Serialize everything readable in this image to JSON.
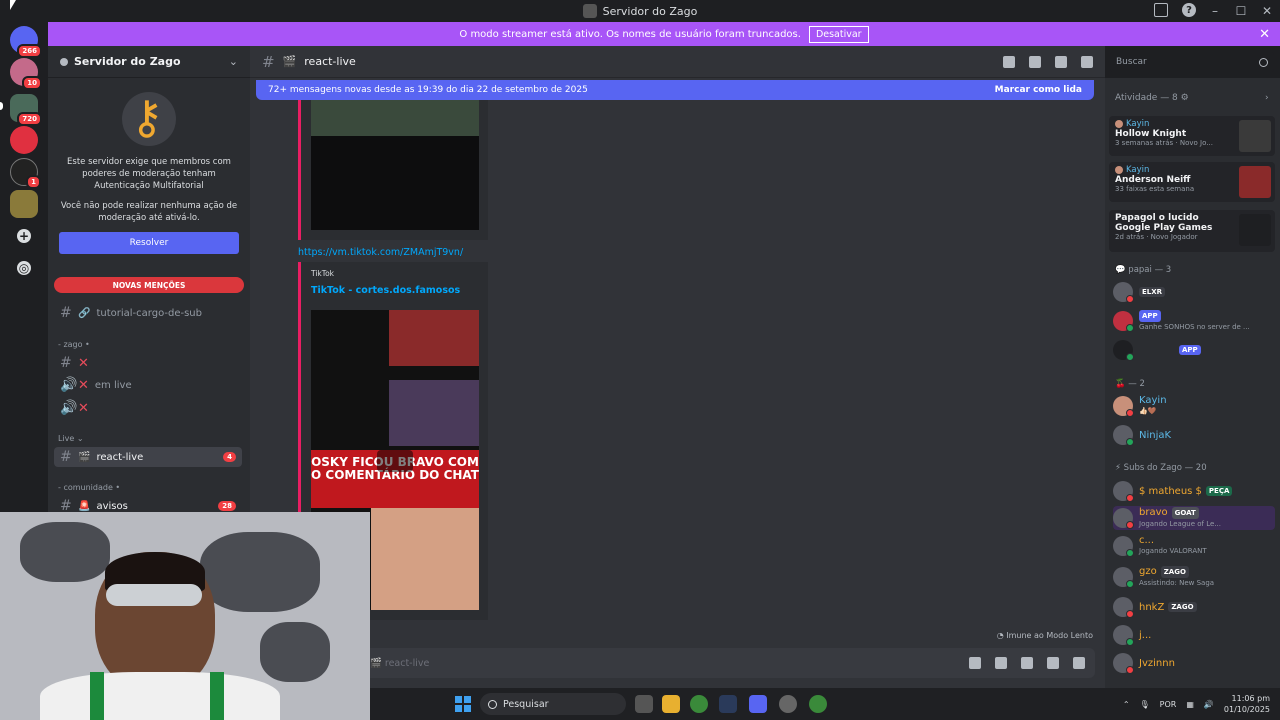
{
  "window": {
    "title": "Servidor do Zago"
  },
  "rail": {
    "badges": [
      "266",
      "10",
      "720",
      "1"
    ]
  },
  "banner": {
    "text": "O modo streamer está ativo. Os nomes de usuário foram truncados.",
    "button": "Desativar"
  },
  "sidebar": {
    "server_name": "Servidor do Zago",
    "mfa_text1": "Este servidor exige que membros com poderes de moderação tenham Autenticação Multifatorial",
    "mfa_text2": "Você não pode realizar nenhuma ação de moderação até ativá-lo.",
    "resolve": "Resolver",
    "new_mentions": "NOVAS MENÇÕES",
    "channels": [
      {
        "name": "tutorial-cargo-de-sub"
      },
      {
        "name": "em live"
      },
      {
        "name": "react-live",
        "count": "4"
      },
      {
        "name": "avisos",
        "count": "28"
      }
    ],
    "categories": [
      "zago",
      "Live",
      "comunidade"
    ]
  },
  "chat": {
    "channel": "react-live",
    "new_messages": "72+ mensagens novas desde as 19:39 do dia 22 de setembro de 2025",
    "mark_read": "Marcar como lida",
    "link": "https://vm.tiktok.com/ZMAmjT9vn/",
    "embed_provider": "TikTok",
    "embed_title": "TikTok - cortes.dos.famosos",
    "video_caption": "OSKY FICOU BRAVO COM O COMENTÁRIO DO CHAT",
    "slow_mode": "Imune ao Modo Lento",
    "composer_placeholder": "react-live"
  },
  "search": {
    "placeholder": "Buscar"
  },
  "members": {
    "activity_header": "Atividade — 8",
    "activities": [
      {
        "who": "Kayin",
        "what": "Hollow Knight",
        "meta": "3 semanas atrás · Novo Jo..."
      },
      {
        "who": "Kayin",
        "what": "Anderson Neiff",
        "meta": "33 faixas esta semana"
      },
      {
        "who": "",
        "what": "Papagol o lucido",
        "what2": "Google Play Games",
        "meta": "2d atrás · Novo Jogador"
      }
    ],
    "group1": "papai — 3",
    "group2": "— 2",
    "group3": "Subs do Zago — 20",
    "list": [
      {
        "name": "",
        "tag": "ELXR"
      },
      {
        "name": "",
        "tag": "APP",
        "sub": "Ganhe SONHOS no server de ..."
      },
      {
        "name": "",
        "tag": "APP"
      },
      {
        "name": "Kayin",
        "sub": ""
      },
      {
        "name": "NinjaK",
        "sub": ""
      },
      {
        "name": "$ matheus $",
        "tag": "PEÇA"
      },
      {
        "name": "bravo",
        "tag": "GOAT",
        "sub": "Jogando League of Le..."
      },
      {
        "name": "c...",
        "sub": "Jogando VALORANT"
      },
      {
        "name": "gzo",
        "tag": "ZAGO",
        "sub": "Assistindo: New Saga"
      },
      {
        "name": "hnkZ",
        "tag": "ZAGO"
      },
      {
        "name": "j..."
      },
      {
        "name": "Jvzinnn"
      }
    ]
  },
  "taskbar": {
    "search": "Pesquisar",
    "lang": "POR",
    "time": "11:06 pm",
    "date": "01/10/2025"
  }
}
